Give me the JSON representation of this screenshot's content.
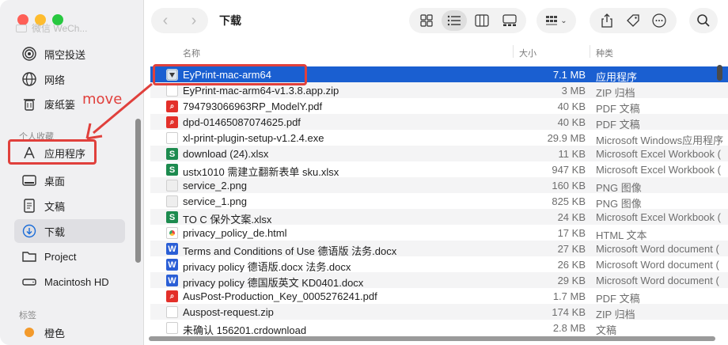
{
  "window": {
    "title": "下载"
  },
  "sidebar": {
    "faded_item": "微信 WeCh...",
    "items": [
      {
        "label": "隔空投送",
        "icon": "airdrop-icon"
      },
      {
        "label": "网络",
        "icon": "globe-icon"
      },
      {
        "label": "废纸篓",
        "icon": "trash-icon"
      }
    ],
    "favorites_title": "个人收藏",
    "favorites": [
      {
        "label": "应用程序",
        "icon": "applications-icon"
      },
      {
        "label": "桌面",
        "icon": "desktop-icon"
      },
      {
        "label": "文稿",
        "icon": "document-icon"
      },
      {
        "label": "下载",
        "icon": "download-icon",
        "selected": true
      },
      {
        "label": "Project",
        "icon": "folder-icon"
      },
      {
        "label": "Macintosh HD",
        "icon": "drive-icon"
      }
    ],
    "tags_title": "标签",
    "tags": [
      {
        "label": "橙色",
        "color": "#f39a2b"
      }
    ]
  },
  "toolbar": {
    "back": "‹",
    "forward": "›"
  },
  "columns": {
    "name": "名称",
    "size": "大小",
    "kind": "种类"
  },
  "files": [
    {
      "name": "EyPrint-mac-arm64",
      "size": "7.1 MB",
      "kind": "应用程序",
      "icon": "app",
      "selected": true
    },
    {
      "name": "EyPrint-mac-arm64-v1.3.8.app.zip",
      "size": "3 MB",
      "kind": "ZIP 归档",
      "icon": "zip"
    },
    {
      "name": "794793066963RP_ModelY.pdf",
      "size": "40 KB",
      "kind": "PDF 文稿",
      "icon": "pdf"
    },
    {
      "name": "dpd-01465087074625.pdf",
      "size": "40 KB",
      "kind": "PDF 文稿",
      "icon": "pdf"
    },
    {
      "name": "xl-print-plugin-setup-v1.2.4.exe",
      "size": "29.9 MB",
      "kind": "Microsoft Windows应用程序",
      "icon": "doc"
    },
    {
      "name": "download (24).xlsx",
      "size": "11 KB",
      "kind": "Microsoft Excel Workbook (",
      "icon": "s"
    },
    {
      "name": "ustx1010 需建立翻新表单 sku.xlsx",
      "size": "947 KB",
      "kind": "Microsoft Excel Workbook (",
      "icon": "s"
    },
    {
      "name": "service_2.png",
      "size": "160 KB",
      "kind": "PNG 图像",
      "icon": "png"
    },
    {
      "name": "service_1.png",
      "size": "825 KB",
      "kind": "PNG 图像",
      "icon": "png"
    },
    {
      "name": "TO C 保外文案.xlsx",
      "size": "24 KB",
      "kind": "Microsoft Excel Workbook (",
      "icon": "s"
    },
    {
      "name": "privacy_policy_de.html",
      "size": "17 KB",
      "kind": "HTML 文本",
      "icon": "html"
    },
    {
      "name": "Terms and Conditions of Use 德语版 法务.docx",
      "size": "27 KB",
      "kind": "Microsoft Word document (",
      "icon": "w"
    },
    {
      "name": "privacy policy 德语版.docx 法务.docx",
      "size": "26 KB",
      "kind": "Microsoft Word document (",
      "icon": "w"
    },
    {
      "name": "privacy policy 德国版英文 KD0401.docx",
      "size": "29 KB",
      "kind": "Microsoft Word document (",
      "icon": "w"
    },
    {
      "name": "AusPost-Production_Key_0005276241.pdf",
      "size": "1.7 MB",
      "kind": "PDF 文稿",
      "icon": "pdf"
    },
    {
      "name": "Auspost-request.zip",
      "size": "174 KB",
      "kind": "ZIP 归档",
      "icon": "zip"
    },
    {
      "name": "未确认 156201.crdownload",
      "size": "2.8 MB",
      "kind": "文稿",
      "icon": "doc"
    }
  ],
  "annotation": {
    "text": "move",
    "color": "#e0403c"
  }
}
